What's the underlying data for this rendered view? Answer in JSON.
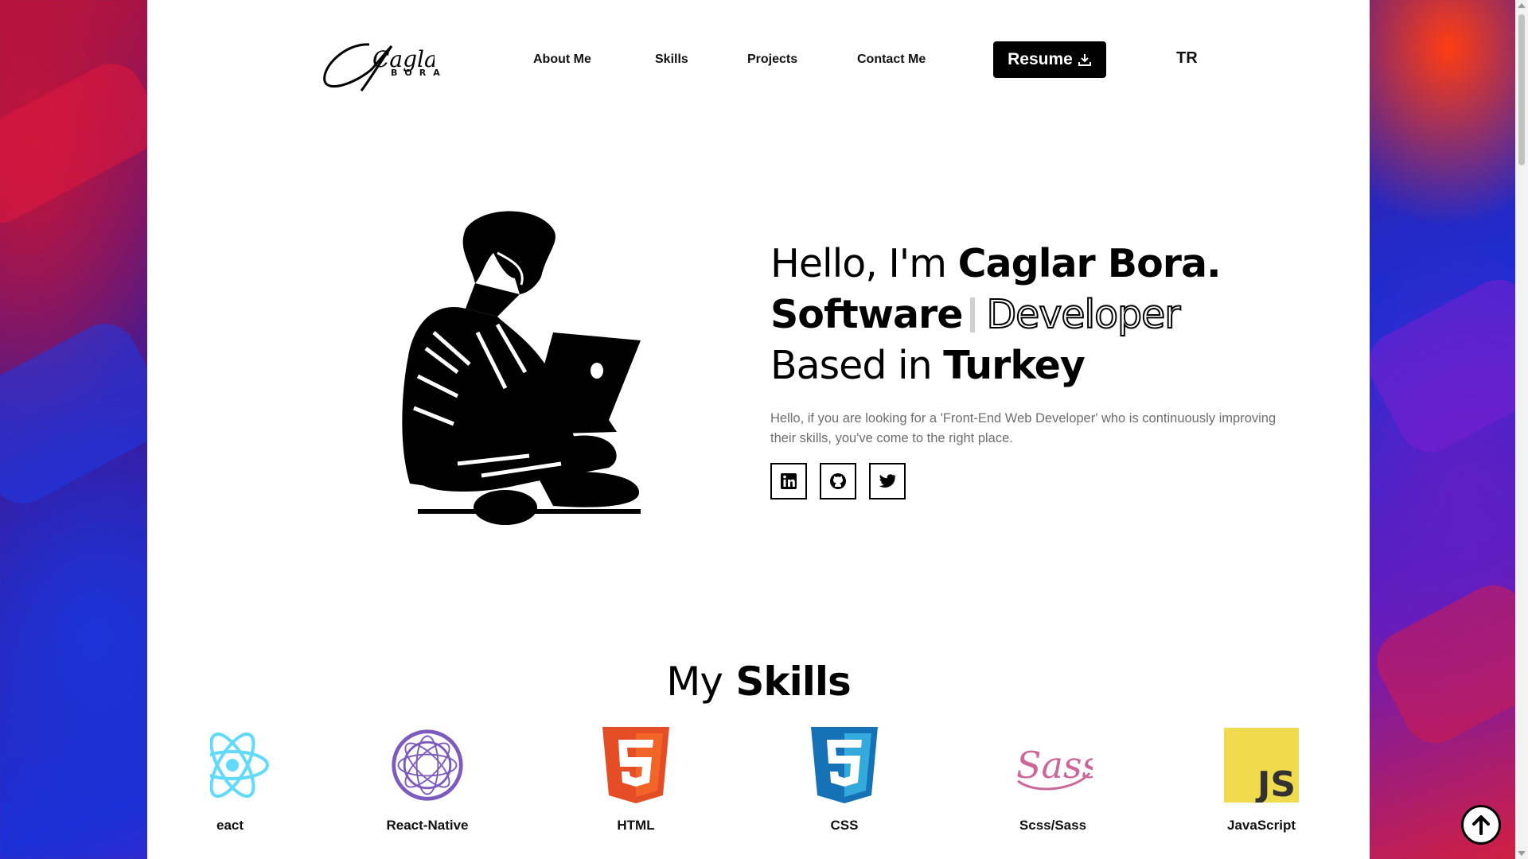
{
  "header": {
    "logo_text": "Caglar",
    "logo_sub": "BORA",
    "nav": [
      "About Me",
      "Skills",
      "Projects",
      "Contact Me"
    ],
    "resume_label": "Resume",
    "lang": "TR"
  },
  "hero": {
    "line1_prefix": "Hello, I'm ",
    "line1_name": "Caglar Bora.",
    "line2_bold": "Software",
    "line2_outline": "Developer",
    "line3_prefix": "Based in ",
    "line3_bold": "Turkey",
    "intro": "Hello, if you are looking for a 'Front-End Web Developer' who is continuously improving their skills, you've come to the right place.",
    "socials": [
      "linkedin-icon",
      "github-icon",
      "twitter-icon"
    ]
  },
  "skills": {
    "title_light": "My",
    "title_bold": "Skills",
    "items": [
      {
        "label": "eact",
        "icon": "react-icon"
      },
      {
        "label": "React-Native",
        "icon": "react-native-icon"
      },
      {
        "label": "HTML",
        "icon": "html5-icon"
      },
      {
        "label": "CSS",
        "icon": "css3-icon"
      },
      {
        "label": "Scss/Sass",
        "icon": "sass-icon"
      },
      {
        "label": "JavaScript",
        "icon": "javascript-icon"
      }
    ]
  },
  "colors": {
    "accent": "#000000",
    "html": "#e44d26",
    "css": "#1572b6",
    "sass": "#cd6799",
    "js": "#f0db4f",
    "react": "#61dafb",
    "react_native": "#7d5bbe"
  }
}
